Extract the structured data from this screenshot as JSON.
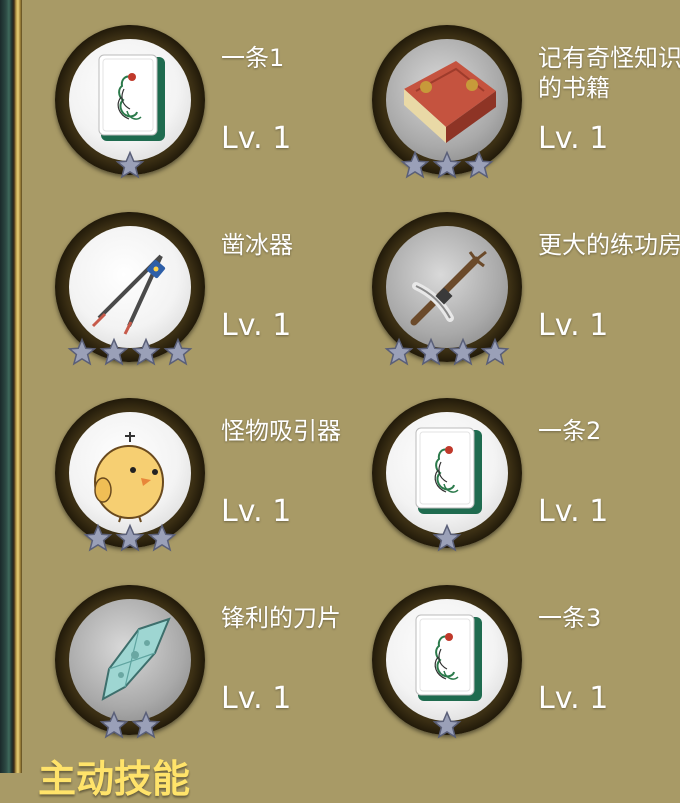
{
  "items": [
    {
      "name": "一条1",
      "level": "Lv. 1",
      "stars": 1,
      "icon": "mahjong-bird-tile-icon"
    },
    {
      "name": "记有奇怪知识的书籍",
      "level": "Lv. 1",
      "stars": 3,
      "icon": "red-book-icon"
    },
    {
      "name": "凿冰器",
      "level": "Lv. 1",
      "stars": 4,
      "icon": "compass-divider-icon"
    },
    {
      "name": "更大的练功房",
      "level": "Lv. 1",
      "stars": 4,
      "icon": "pickaxe-icon"
    },
    {
      "name": "怪物吸引器",
      "level": "Lv. 1",
      "stars": 3,
      "icon": "yellow-chick-icon"
    },
    {
      "name": "一条2",
      "level": "Lv. 1",
      "stars": 1,
      "icon": "mahjong-bird-tile-icon"
    },
    {
      "name": "锋利的刀片",
      "level": "Lv. 1",
      "stars": 2,
      "icon": "crystal-blade-icon"
    },
    {
      "name": "一条3",
      "level": "Lv. 1",
      "stars": 1,
      "icon": "mahjong-bird-tile-icon"
    }
  ],
  "section": {
    "title": "主动技能"
  },
  "colors": {
    "background": "#a89a66",
    "star": "#9aa0b8",
    "section_title": "#ffe36a"
  }
}
